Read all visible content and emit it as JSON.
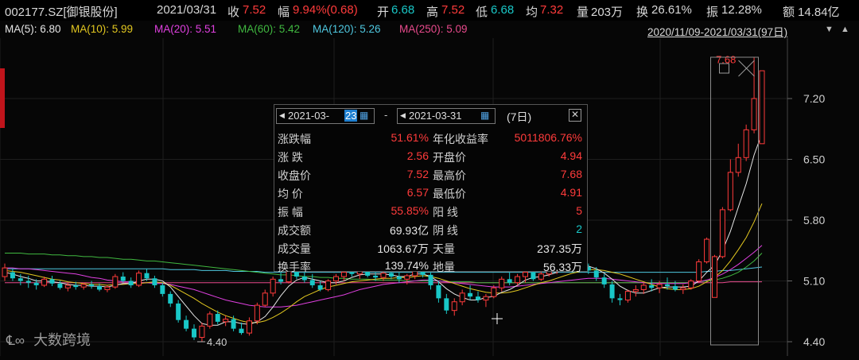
{
  "header": {
    "code": "002177.SZ[御银股份]",
    "date": "2021/03/31",
    "close_label": "收",
    "close": "7.52",
    "chg_label": "幅",
    "chg": "9.94%(0.68)",
    "open_label": "开",
    "open": "6.68",
    "high_label": "高",
    "high": "7.52",
    "low_label": "低",
    "low": "6.68",
    "avg_label": "均",
    "avg": "7.32",
    "vol_label": "量",
    "vol": "203万",
    "turnover_label": "换",
    "turnover": "26.61%",
    "amp_label": "振",
    "amp": "12.28%",
    "amount_label": "额",
    "amount": "14.84亿"
  },
  "ma": {
    "ma5": "MA(5): 6.80",
    "ma10": "MA(10): 5.99",
    "ma20": "MA(20): 5.51",
    "ma60": "MA(60): 5.42",
    "ma120": "MA(120): 5.26",
    "ma250": "MA(250): 5.09",
    "range": "2020/11/09-2021/03/31(97日)"
  },
  "colors": {
    "up": "#ff3b3b",
    "down": "#19c7c7",
    "ma5": "#e6e6e6",
    "ma10": "#e3c820",
    "ma20": "#e040e0",
    "ma60": "#40b840",
    "ma120": "#4fc8e0",
    "ma250": "#e84a8c",
    "tab_red": "#c0141b"
  },
  "chart_data": {
    "type": "candlestick",
    "y_axis_labels": [
      "7.20",
      "6.50",
      "5.80",
      "5.10",
      "4.40"
    ],
    "y_axis_values": [
      7.2,
      6.5,
      5.8,
      5.1,
      4.4
    ],
    "min_label": "4.40",
    "max_label": "7.68",
    "candles": [
      [
        5.15,
        5.3,
        5.1,
        5.25
      ],
      [
        5.2,
        5.24,
        5.1,
        5.13
      ],
      [
        5.13,
        5.18,
        5.05,
        5.1
      ],
      [
        5.1,
        5.16,
        5.02,
        5.08
      ],
      [
        5.08,
        5.12,
        5.0,
        5.05
      ],
      [
        5.05,
        5.15,
        5.03,
        5.12
      ],
      [
        5.12,
        5.16,
        5.04,
        5.07
      ],
      [
        5.07,
        5.1,
        5.0,
        5.02
      ],
      [
        5.02,
        5.08,
        4.98,
        5.05
      ],
      [
        5.05,
        5.09,
        5.0,
        5.03
      ],
      [
        5.03,
        5.08,
        5.0,
        5.06
      ],
      [
        5.06,
        5.1,
        5.01,
        5.04
      ],
      [
        5.04,
        5.07,
        4.98,
        5.0
      ],
      [
        5.0,
        5.05,
        4.97,
        5.03
      ],
      [
        5.03,
        5.18,
        5.01,
        5.15
      ],
      [
        5.15,
        5.2,
        5.08,
        5.1
      ],
      [
        5.1,
        5.14,
        5.02,
        5.05
      ],
      [
        5.05,
        5.22,
        5.03,
        5.19
      ],
      [
        5.19,
        5.24,
        5.1,
        5.13
      ],
      [
        5.13,
        5.16,
        5.02,
        5.05
      ],
      [
        5.05,
        5.08,
        4.92,
        4.95
      ],
      [
        4.95,
        4.98,
        4.8,
        4.84
      ],
      [
        4.84,
        4.88,
        4.62,
        4.65
      ],
      [
        4.65,
        4.7,
        4.52,
        4.55
      ],
      [
        4.55,
        4.6,
        4.42,
        4.45
      ],
      [
        4.45,
        4.62,
        4.4,
        4.58
      ],
      [
        4.58,
        4.75,
        4.55,
        4.72
      ],
      [
        4.72,
        4.76,
        4.6,
        4.63
      ],
      [
        4.63,
        4.7,
        4.58,
        4.66
      ],
      [
        4.66,
        4.7,
        4.52,
        4.55
      ],
      [
        4.55,
        4.62,
        4.48,
        4.5
      ],
      [
        4.5,
        4.68,
        4.47,
        4.64
      ],
      [
        4.64,
        4.85,
        4.6,
        4.82
      ],
      [
        4.82,
        5.0,
        4.8,
        4.96
      ],
      [
        4.96,
        5.15,
        4.92,
        5.12
      ],
      [
        5.12,
        5.2,
        5.06,
        5.09
      ],
      [
        5.09,
        5.25,
        5.07,
        5.22
      ],
      [
        5.22,
        5.3,
        5.12,
        5.15
      ],
      [
        5.15,
        5.2,
        5.08,
        5.11
      ],
      [
        5.11,
        5.18,
        5.02,
        5.05
      ],
      [
        5.05,
        5.1,
        4.98,
        5.0
      ],
      [
        5.0,
        5.12,
        4.98,
        5.1
      ],
      [
        5.1,
        5.18,
        5.06,
        5.15
      ],
      [
        5.15,
        5.25,
        5.1,
        5.2
      ],
      [
        5.2,
        5.3,
        5.15,
        5.18
      ],
      [
        5.18,
        5.24,
        5.12,
        5.22
      ],
      [
        5.22,
        5.28,
        5.14,
        5.16
      ],
      [
        5.16,
        5.2,
        5.1,
        5.14
      ],
      [
        5.14,
        5.22,
        5.1,
        5.19
      ],
      [
        5.19,
        5.26,
        5.12,
        5.15
      ],
      [
        5.15,
        5.2,
        5.08,
        5.12
      ],
      [
        5.12,
        5.18,
        5.06,
        5.16
      ],
      [
        5.16,
        5.3,
        5.12,
        5.26
      ],
      [
        5.26,
        5.3,
        5.14,
        5.17
      ],
      [
        5.17,
        5.2,
        5.0,
        5.05
      ],
      [
        5.05,
        5.1,
        4.85,
        4.9
      ],
      [
        4.9,
        4.95,
        4.72,
        4.76
      ],
      [
        4.76,
        4.9,
        4.7,
        4.86
      ],
      [
        4.86,
        5.0,
        4.82,
        4.96
      ],
      [
        4.96,
        5.05,
        4.88,
        4.92
      ],
      [
        4.92,
        4.98,
        4.85,
        4.88
      ],
      [
        4.88,
        4.95,
        4.8,
        4.92
      ],
      [
        4.92,
        5.05,
        4.9,
        5.02
      ],
      [
        5.02,
        5.15,
        4.98,
        5.12
      ],
      [
        5.12,
        5.2,
        5.05,
        5.08
      ],
      [
        5.08,
        5.18,
        5.05,
        5.15
      ],
      [
        5.15,
        5.24,
        5.08,
        5.2
      ],
      [
        5.2,
        5.25,
        5.1,
        5.12
      ],
      [
        5.12,
        5.22,
        5.1,
        5.18
      ],
      [
        5.18,
        5.28,
        5.15,
        5.24
      ],
      [
        5.24,
        5.3,
        5.18,
        5.27
      ],
      [
        5.27,
        5.34,
        5.2,
        5.3
      ],
      [
        5.3,
        5.36,
        5.24,
        5.28
      ],
      [
        5.28,
        5.32,
        5.22,
        5.26
      ],
      [
        5.26,
        5.3,
        5.18,
        5.22
      ],
      [
        5.22,
        5.26,
        5.1,
        5.14
      ],
      [
        5.14,
        5.18,
        5.02,
        5.06
      ],
      [
        5.06,
        5.1,
        4.85,
        4.9
      ],
      [
        4.9,
        4.95,
        4.82,
        4.88
      ],
      [
        4.88,
        5.0,
        4.85,
        4.98
      ],
      [
        4.98,
        5.05,
        4.92,
        5.0
      ],
      [
        5.0,
        5.08,
        4.95,
        5.05
      ],
      [
        5.05,
        5.12,
        4.98,
        5.02
      ],
      [
        5.02,
        5.1,
        4.96,
        5.06
      ],
      [
        5.06,
        5.14,
        5.0,
        5.04
      ],
      [
        5.04,
        5.1,
        4.98,
        5.0
      ],
      [
        5.0,
        5.06,
        4.95,
        5.02
      ],
      [
        5.02,
        5.12,
        5.0,
        5.1
      ],
      [
        5.1,
        5.35,
        5.08,
        5.32
      ],
      [
        5.32,
        5.6,
        5.3,
        5.58
      ],
      [
        4.91,
        5.4,
        4.91,
        5.38
      ],
      [
        5.38,
        5.95,
        5.36,
        5.92
      ],
      [
        5.92,
        6.5,
        5.9,
        6.35
      ],
      [
        6.35,
        6.68,
        6.3,
        6.52
      ],
      [
        6.52,
        6.9,
        6.48,
        6.84
      ],
      [
        6.84,
        7.68,
        6.8,
        7.2
      ],
      [
        6.68,
        7.52,
        6.68,
        7.52
      ]
    ],
    "ma5": [
      5.2,
      5.18,
      5.15,
      5.13,
      5.1,
      5.1,
      5.09,
      5.08,
      5.06,
      5.05,
      5.05,
      5.04,
      5.04,
      5.03,
      5.05,
      5.07,
      5.07,
      5.1,
      5.12,
      5.12,
      5.1,
      5.03,
      4.92,
      4.81,
      4.7,
      4.61,
      4.59,
      4.59,
      4.63,
      4.63,
      4.61,
      4.6,
      4.63,
      4.69,
      4.8,
      4.93,
      5.04,
      5.11,
      5.14,
      5.12,
      5.1,
      5.08,
      5.08,
      5.1,
      5.14,
      5.17,
      5.18,
      5.18,
      5.18,
      5.17,
      5.15,
      5.15,
      5.18,
      5.18,
      5.15,
      5.09,
      5.01,
      4.95,
      4.91,
      4.88,
      4.88,
      4.91,
      4.92,
      4.97,
      5.0,
      5.05,
      5.11,
      5.14,
      5.15,
      5.17,
      5.2,
      5.24,
      5.27,
      5.27,
      5.27,
      5.24,
      5.19,
      5.12,
      5.04,
      4.99,
      4.96,
      4.96,
      4.99,
      5.02,
      5.03,
      5.03,
      5.03,
      5.04,
      5.1,
      5.2,
      5.28,
      5.45,
      5.67,
      5.95,
      6.22,
      6.55,
      6.8
    ],
    "ma10": [
      5.22,
      5.21,
      5.2,
      5.18,
      5.16,
      5.14,
      5.12,
      5.11,
      5.09,
      5.08,
      5.07,
      5.06,
      5.06,
      5.05,
      5.06,
      5.06,
      5.07,
      5.07,
      5.08,
      5.09,
      5.08,
      5.05,
      5.0,
      4.95,
      4.9,
      4.84,
      4.79,
      4.74,
      4.7,
      4.67,
      4.64,
      4.62,
      4.62,
      4.64,
      4.68,
      4.73,
      4.79,
      4.86,
      4.92,
      4.96,
      5.0,
      5.03,
      5.05,
      5.07,
      5.09,
      5.1,
      5.11,
      5.12,
      5.13,
      5.13,
      5.14,
      5.14,
      5.15,
      5.16,
      5.15,
      5.13,
      5.1,
      5.07,
      5.04,
      5.01,
      4.99,
      4.97,
      4.96,
      4.96,
      4.97,
      4.99,
      5.02,
      5.05,
      5.08,
      5.1,
      5.13,
      5.16,
      5.19,
      5.21,
      5.23,
      5.23,
      5.22,
      5.2,
      5.18,
      5.15,
      5.12,
      5.09,
      5.06,
      5.03,
      5.01,
      5.0,
      5.0,
      5.01,
      5.04,
      5.09,
      5.14,
      5.22,
      5.33,
      5.46,
      5.6,
      5.78,
      5.99
    ],
    "ma20": [
      5.25,
      5.25,
      5.24,
      5.24,
      5.23,
      5.22,
      5.21,
      5.2,
      5.19,
      5.18,
      5.16,
      5.14,
      5.13,
      5.11,
      5.1,
      5.09,
      5.09,
      5.08,
      5.08,
      5.07,
      5.07,
      5.06,
      5.04,
      5.02,
      5.0,
      4.97,
      4.94,
      4.91,
      4.88,
      4.86,
      4.84,
      4.82,
      4.81,
      4.8,
      4.8,
      4.8,
      4.81,
      4.82,
      4.84,
      4.86,
      4.88,
      4.9,
      4.92,
      4.94,
      4.97,
      5.0,
      5.02,
      5.04,
      5.06,
      5.07,
      5.08,
      5.09,
      5.1,
      5.11,
      5.11,
      5.1,
      5.09,
      5.08,
      5.07,
      5.06,
      5.05,
      5.04,
      5.03,
      5.03,
      5.03,
      5.04,
      5.05,
      5.06,
      5.07,
      5.08,
      5.09,
      5.1,
      5.11,
      5.12,
      5.13,
      5.13,
      5.13,
      5.12,
      5.11,
      5.1,
      5.09,
      5.08,
      5.07,
      5.07,
      5.07,
      5.07,
      5.07,
      5.08,
      5.09,
      5.11,
      5.14,
      5.18,
      5.23,
      5.29,
      5.36,
      5.43,
      5.51
    ],
    "ma60": [
      5.42,
      5.42,
      5.42,
      5.41,
      5.41,
      5.41,
      5.4,
      5.4,
      5.39,
      5.39,
      5.38,
      5.38,
      5.37,
      5.37,
      5.36,
      5.35,
      5.35,
      5.34,
      5.33,
      5.33,
      5.32,
      5.31,
      5.3,
      5.29,
      5.28,
      5.27,
      5.26,
      5.25,
      5.24,
      5.23,
      5.22,
      5.21,
      5.2,
      5.19,
      5.18,
      5.17,
      5.17,
      5.16,
      5.15,
      5.15,
      5.14,
      5.14,
      5.13,
      5.13,
      5.12,
      5.12,
      5.12,
      5.11,
      5.11,
      5.11,
      5.11,
      5.1,
      5.1,
      5.1,
      5.1,
      5.1,
      5.09,
      5.09,
      5.09,
      5.09,
      5.08,
      5.08,
      5.08,
      5.08,
      5.08,
      5.08,
      5.08,
      5.08,
      5.08,
      5.08,
      5.08,
      5.08,
      5.08,
      5.08,
      5.08,
      5.08,
      5.08,
      5.08,
      5.08,
      5.08,
      5.08,
      5.08,
      5.08,
      5.08,
      5.08,
      5.08,
      5.08,
      5.08,
      5.09,
      5.1,
      5.11,
      5.13,
      5.16,
      5.2,
      5.26,
      5.33,
      5.42
    ],
    "ma120": [
      5.24,
      5.24,
      5.24,
      5.24,
      5.24,
      5.24,
      5.24,
      5.24,
      5.24,
      5.24,
      5.24,
      5.24,
      5.24,
      5.24,
      5.24,
      5.24,
      5.24,
      5.24,
      5.24,
      5.24,
      5.24,
      5.23,
      5.23,
      5.23,
      5.23,
      5.22,
      5.22,
      5.22,
      5.22,
      5.21,
      5.21,
      5.21,
      5.21,
      5.2,
      5.2,
      5.2,
      5.2,
      5.2,
      5.2,
      5.2,
      5.2,
      5.2,
      5.2,
      5.2,
      5.2,
      5.2,
      5.2,
      5.2,
      5.2,
      5.2,
      5.2,
      5.2,
      5.2,
      5.2,
      5.2,
      5.2,
      5.2,
      5.2,
      5.2,
      5.2,
      5.2,
      5.2,
      5.2,
      5.2,
      5.2,
      5.2,
      5.2,
      5.2,
      5.2,
      5.2,
      5.2,
      5.2,
      5.2,
      5.2,
      5.2,
      5.2,
      5.2,
      5.2,
      5.2,
      5.2,
      5.2,
      5.2,
      5.2,
      5.2,
      5.2,
      5.2,
      5.2,
      5.2,
      5.2,
      5.21,
      5.21,
      5.22,
      5.22,
      5.23,
      5.24,
      5.25,
      5.26
    ],
    "ma250": [
      5.08,
      5.08,
      5.08,
      5.08,
      5.08,
      5.08,
      5.08,
      5.08,
      5.08,
      5.08,
      5.08,
      5.08,
      5.08,
      5.08,
      5.08,
      5.08,
      5.08,
      5.08,
      5.08,
      5.08,
      5.08,
      5.08,
      5.08,
      5.08,
      5.08,
      5.08,
      5.08,
      5.08,
      5.08,
      5.08,
      5.08,
      5.08,
      5.08,
      5.08,
      5.08,
      5.08,
      5.08,
      5.08,
      5.08,
      5.08,
      5.08,
      5.08,
      5.08,
      5.08,
      5.08,
      5.08,
      5.08,
      5.08,
      5.08,
      5.08,
      5.08,
      5.08,
      5.08,
      5.08,
      5.08,
      5.08,
      5.08,
      5.08,
      5.08,
      5.08,
      5.08,
      5.08,
      5.08,
      5.08,
      5.08,
      5.08,
      5.08,
      5.08,
      5.08,
      5.08,
      5.08,
      5.08,
      5.08,
      5.08,
      5.08,
      5.08,
      5.08,
      5.08,
      5.08,
      5.08,
      5.08,
      5.08,
      5.08,
      5.08,
      5.08,
      5.08,
      5.08,
      5.08,
      5.08,
      5.08,
      5.08,
      5.08,
      5.09,
      5.09,
      5.09,
      5.09,
      5.09
    ]
  },
  "range_panel": {
    "start_prefix": "2021-03-",
    "start_day": "23",
    "dash": "-",
    "end_date": "2021-03-31",
    "days": "(7日)",
    "rows": [
      {
        "k1": "涨跌幅",
        "v1": "51.61%",
        "k2": "年化收益率",
        "v2": "5011806.76%",
        "c1": "#ff3b3b",
        "c2": "#ff3b3b"
      },
      {
        "k1": "涨  跌",
        "v1": "2.56",
        "k2": "开盘价",
        "v2": "4.94",
        "c1": "#ff3b3b",
        "c2": "#ff3b3b"
      },
      {
        "k1": "收盘价",
        "v1": "7.52",
        "k2": "最高价",
        "v2": "7.68",
        "c1": "#ff3b3b",
        "c2": "#ff3b3b"
      },
      {
        "k1": "均  价",
        "v1": "6.57",
        "k2": "最低价",
        "v2": "4.91",
        "c1": "#ff3b3b",
        "c2": "#ff3b3b"
      },
      {
        "k1": "振  幅",
        "v1": "55.85%",
        "k2": "阳  线",
        "v2": "5",
        "c1": "#ff3b3b",
        "c2": "#ff3b3b"
      },
      {
        "k1": "成交额",
        "v1": "69.93亿",
        "k2": "阴  线",
        "v2": "2",
        "c1": "#e6e6e6",
        "c2": "#19c7c7"
      },
      {
        "k1": "成交量",
        "v1": "1063.67万",
        "k2": "天量",
        "v2": "237.35万",
        "c1": "#e6e6e6",
        "c2": "#e6e6e6"
      },
      {
        "k1": "换手率",
        "v1": "139.74%",
        "k2": "地量",
        "v2": "56.33万",
        "c1": "#e6e6e6",
        "c2": "#e6e6e6"
      }
    ]
  },
  "watermark": "大数跨境"
}
